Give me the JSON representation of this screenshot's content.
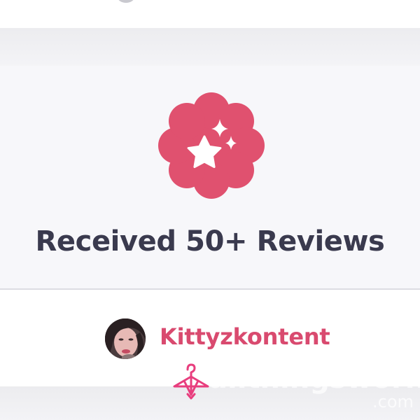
{
  "badge": {
    "title": "Received 50+ Reviews",
    "icon": "sparkle-star-badge-icon",
    "color": "#e0516f"
  },
  "seller": {
    "name": "Kittyzkontent",
    "name_color": "#d94a6f",
    "avatar": "seller-avatar"
  },
  "watermark": {
    "icon": "hanger-icon",
    "text": "allthingsworn",
    "suffix": ".com",
    "accent": "#e83e7e"
  }
}
